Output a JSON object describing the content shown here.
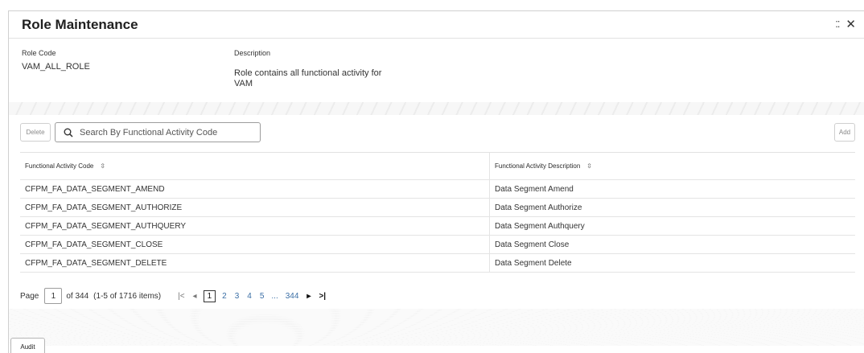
{
  "window": {
    "title": "Role Maintenance",
    "expand_glyph": "⁚⁚",
    "close_glyph": "✕"
  },
  "fields": {
    "role_code": {
      "label": "Role Code",
      "value": "VAM_ALL_ROLE"
    },
    "description": {
      "label": "Description",
      "value": "Role contains all functional activity for VAM"
    }
  },
  "toolbar": {
    "delete_label": "Delete",
    "add_label": "Add",
    "search_placeholder": "Search By Functional Activity Code",
    "search_icon": "search-icon"
  },
  "table": {
    "columns": [
      "Functional Activity Code",
      "Functional Activity Description"
    ],
    "sort_glyph": "⇳",
    "rows": [
      [
        "CFPM_FA_DATA_SEGMENT_AMEND",
        "Data Segment Amend"
      ],
      [
        "CFPM_FA_DATA_SEGMENT_AUTHORIZE",
        "Data Segment Authorize"
      ],
      [
        "CFPM_FA_DATA_SEGMENT_AUTHQUERY",
        "Data Segment Authquery"
      ],
      [
        "CFPM_FA_DATA_SEGMENT_CLOSE",
        "Data Segment Close"
      ],
      [
        "CFPM_FA_DATA_SEGMENT_DELETE",
        "Data Segment Delete"
      ]
    ]
  },
  "pager": {
    "page_label": "Page",
    "current_page": "1",
    "of_text": "of 344",
    "range_text": "(1-5 of 1716 items)",
    "first_glyph": "|<",
    "prev_glyph": "◂",
    "next_glyph": "▸",
    "last_glyph": ">|",
    "pages": [
      "1",
      "2",
      "3",
      "4",
      "5"
    ],
    "ellipsis": "...",
    "last_page": "344"
  },
  "footer": {
    "audit_label": "Audit"
  },
  "colors": {
    "link": "#3a6ea5",
    "border": "#e4e4e4",
    "text": "#333333"
  }
}
